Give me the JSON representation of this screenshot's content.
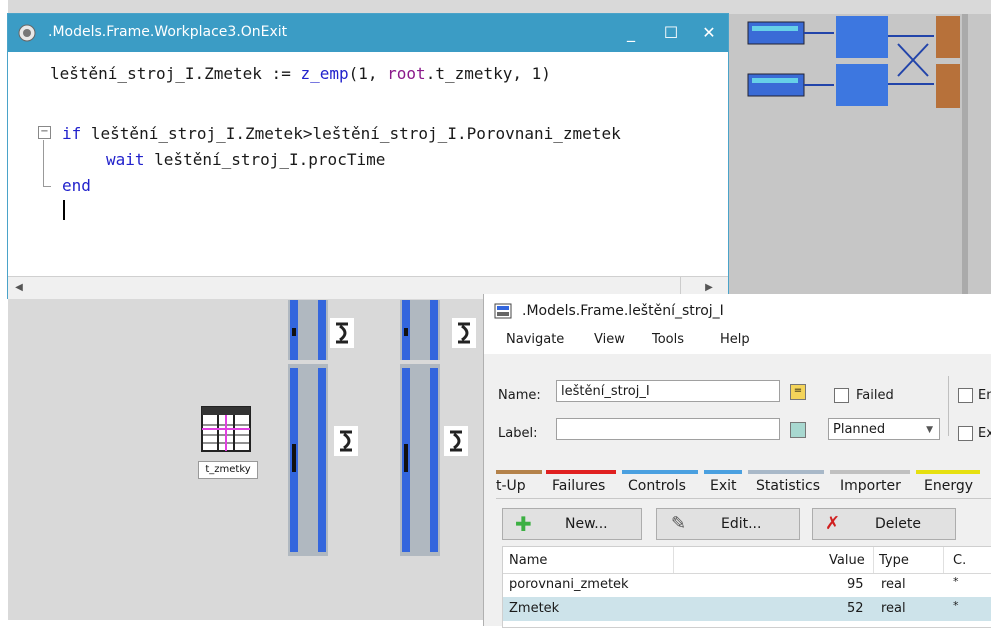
{
  "editor": {
    "title": ".Models.Frame.Workplace3.OnExit",
    "code": {
      "line1_var": "leštění_stroj_I.Zmetek := ",
      "line1_fn": "z_emp",
      "line1_args_a": "(1, ",
      "line1_root": "root",
      "line1_args_b": ".t_zmetky, 1)",
      "line3_kw": "if",
      "line3_cond": " leštění_stroj_I.Zmetek>leštění_stroj_I.Porovnani_zmetek",
      "line4_kw": "wait",
      "line4_rest": " leštění_stroj_I.procTime",
      "line5_kw": "end"
    }
  },
  "canvas": {
    "table_object_label": "t_zmetky"
  },
  "attributes_window": {
    "title": ".Models.Frame.leštění_stroj_I",
    "menu": [
      "Navigate",
      "View",
      "Tools",
      "Help"
    ],
    "name_label": "Name:",
    "name_value": "leštění_stroj_I",
    "label_label": "Label:",
    "label_value": "",
    "failed_label": "Failed",
    "planned_value": "Planned",
    "en_label": "En",
    "ex_label": "Ex",
    "tabs": [
      "t-Up",
      "Failures",
      "Controls",
      "Exit",
      "Statistics",
      "Importer",
      "Energy"
    ],
    "buttons": {
      "new": "New...",
      "edit": "Edit...",
      "delete": "Delete"
    },
    "table": {
      "headers": [
        "Name",
        "Value",
        "Type",
        "C."
      ],
      "rows": [
        {
          "name": "porovnani_zmetek",
          "value": "95",
          "type": "real",
          "c": "*"
        },
        {
          "name": "Zmetek",
          "value": "52",
          "type": "real",
          "c": "*"
        }
      ]
    }
  }
}
